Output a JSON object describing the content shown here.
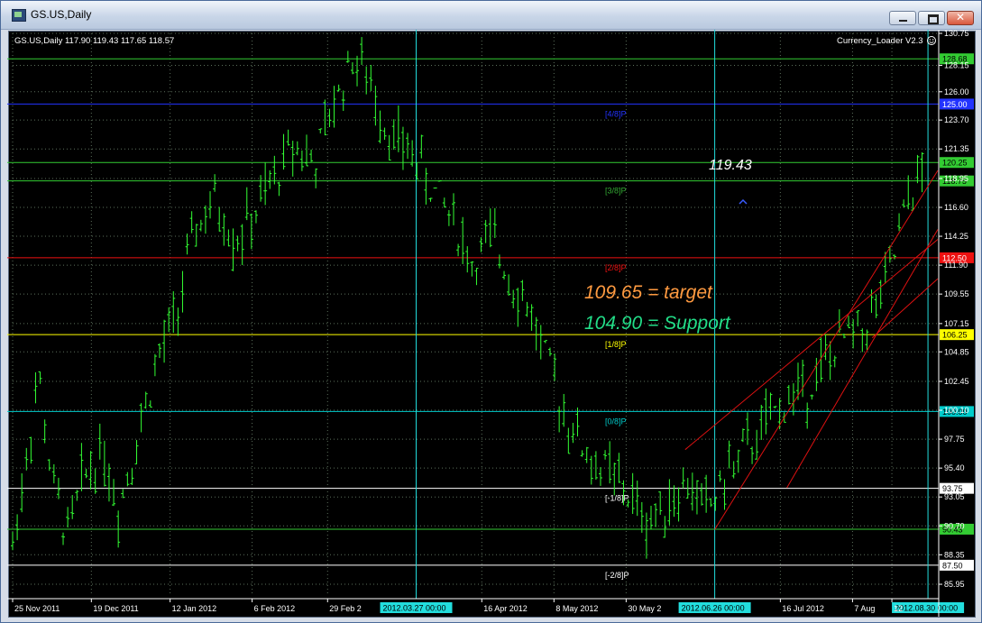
{
  "window": {
    "title": "GS.US,Daily",
    "buttons": [
      "minimize",
      "maximize",
      "close"
    ]
  },
  "chart_data": {
    "type": "ohlc",
    "symbol_header": "GS.US,Daily  117.90 119.43 117.65 118.57",
    "indicator_label": "Currency_Loader V2.3",
    "indicator_icon": "smiley-icon",
    "ylim": [
      85.0,
      130.75
    ],
    "y_ticks": [
      "130.75",
      "128.15",
      "126.00",
      "123.70",
      "121.35",
      "118.95",
      "116.60",
      "114.25",
      "111.90",
      "109.55",
      "107.15",
      "104.85",
      "102.45",
      "100.10",
      "97.75",
      "95.40",
      "93.05",
      "90.70",
      "88.35",
      "85.95"
    ],
    "x_ticks": [
      "25 Nov 2011",
      "19 Dec 2011",
      "12 Jan 2012",
      "6 Feb 2012",
      "29 Feb 2",
      "16 Apr 2012",
      "8 May 2012",
      "30 May 2",
      "16 Jul 2012",
      "7 Aug",
      "12"
    ],
    "x_tick_days": [
      0,
      24,
      48,
      73,
      96,
      143,
      165,
      187,
      234,
      256,
      268
    ],
    "x_highlights": [
      {
        "label": "2012.03.27 00:00",
        "day": 123
      },
      {
        "label": "2012.06.26 00:00",
        "day": 214
      },
      {
        "label": "2012.08.30 00:00",
        "day": 279
      }
    ],
    "murrey_lines": [
      {
        "price": 128.68,
        "label": "",
        "line": "#33cc33",
        "box": "#33cc33",
        "text": "#000000"
      },
      {
        "price": 125.0,
        "label": "[4/8]P",
        "line": "#2233ff",
        "box": "#2233ff",
        "text": "#ffffff"
      },
      {
        "price": 120.25,
        "label": "",
        "line": "#33cc33",
        "box": "#33cc33",
        "text": "#000000"
      },
      {
        "price": 118.75,
        "label": "[3/8]P",
        "line": "#33cc33",
        "box": "#33cc33",
        "text": "#000000"
      },
      {
        "price": 112.5,
        "label": "[2/8]P",
        "line": "#ee1111",
        "box": "#ee1111",
        "text": "#ffffff"
      },
      {
        "price": 106.25,
        "label": "[1/8]P",
        "line": "#ffff00",
        "box": "#ffff00",
        "text": "#000000"
      },
      {
        "price": 100.0,
        "label": "[0/8]P",
        "line": "#00cccc",
        "box": "#00cccc",
        "text": "#000000"
      },
      {
        "price": 93.75,
        "label": "[-1/8]P",
        "line": "#ffffff",
        "box": "#ffffff",
        "text": "#000000"
      },
      {
        "price": 90.43,
        "label": "",
        "line": "#33cc33",
        "box": "#33cc33",
        "text": "#000000"
      },
      {
        "price": 87.5,
        "label": "[-2/8]P",
        "line": "#ffffff",
        "box": "#ffffff",
        "text": "#000000"
      }
    ],
    "annotations": {
      "high": "119.43",
      "target": "109.65 = target",
      "support": "104.90 = Support"
    },
    "colors": {
      "bars": "#33ff33",
      "grid": "#5c6f5c",
      "vlines": "#22dddd",
      "trendlines": "#dd1111",
      "target_text": "#ff9a40",
      "support_text": "#22dd88"
    },
    "series": [
      {
        "values_ohlc_note": "daily OHLC bars Nov 2011 – Sep 2012"
      }
    ],
    "grid": true
  }
}
